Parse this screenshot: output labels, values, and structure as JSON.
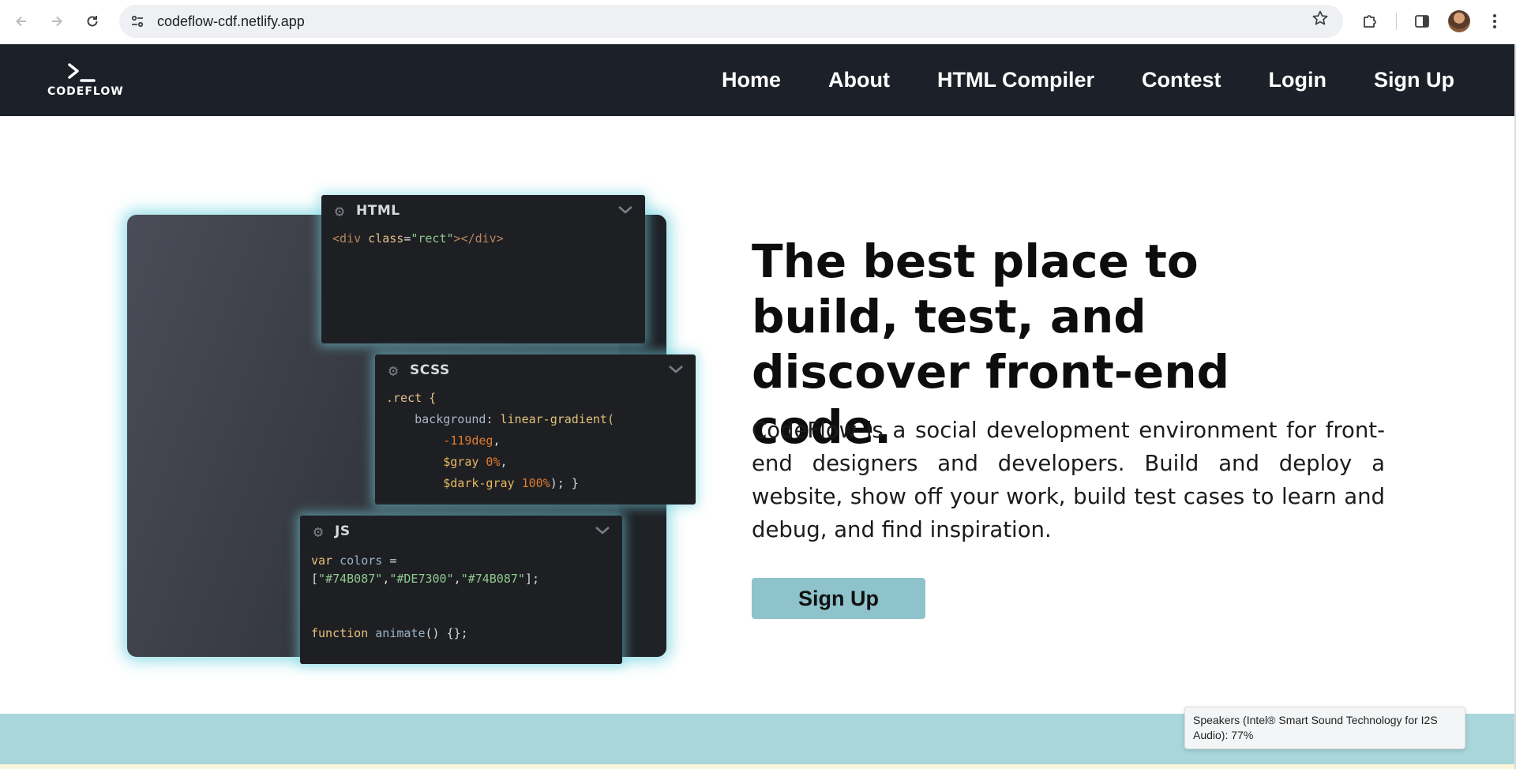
{
  "browser": {
    "url": "codeflow-cdf.netlify.app",
    "back_icon": "arrow-left-icon",
    "forward_icon": "arrow-right-icon",
    "reload_icon": "reload-icon"
  },
  "site": {
    "logo_text": "CODEFLOW",
    "nav": [
      "Home",
      "About",
      "HTML Compiler",
      "Contest",
      "Login",
      "Sign Up"
    ]
  },
  "editors": {
    "html": {
      "title": "HTML",
      "code": {
        "open": "<div ",
        "attr": "class",
        "eq": "=",
        "val": "\"rect\"",
        "close": "></div>"
      }
    },
    "scss": {
      "title": "SCSS",
      "lines": {
        "l1": ".rect {",
        "l2_prop": "background",
        "l2_sep": ": ",
        "l2_fn": "linear-gradient(",
        "l3": "-119deg",
        "l3_end": ",",
        "l4_var": "$gray",
        "l4_num": " 0%",
        "l4_end": ",",
        "l5_var": "$dark-gray",
        "l5_num": " 100%",
        "l5_end": "); }"
      }
    },
    "js": {
      "title": "JS",
      "lines": {
        "l1_kw": "var",
        "l1_id": " colors",
        "l1_end": " =",
        "l2_open": "[",
        "l2_a": "\"#74B087\"",
        "l2_b": "\"#DE7300\"",
        "l2_c": "\"#74B087\"",
        "l2_close": "];",
        "l3_kw": "function",
        "l3_id": " animate",
        "l3_end": "() {};"
      }
    }
  },
  "hero": {
    "title": "The best place to build, test, and discover front-end code.",
    "description": "CodeFlow is a social development environment for front-end designers and developers. Build and deploy a website, show off your work, build test cases to learn and debug, and find inspiration.",
    "cta": "Sign Up"
  },
  "toast": {
    "text": "Speakers (Intel® Smart Sound Technology for I2S Audio): 77%"
  },
  "colors": {
    "nav_bg": "#1c2129",
    "cta_bg": "#8ec3cc",
    "band": "#a8d6da",
    "glow": "#78d6e2"
  }
}
